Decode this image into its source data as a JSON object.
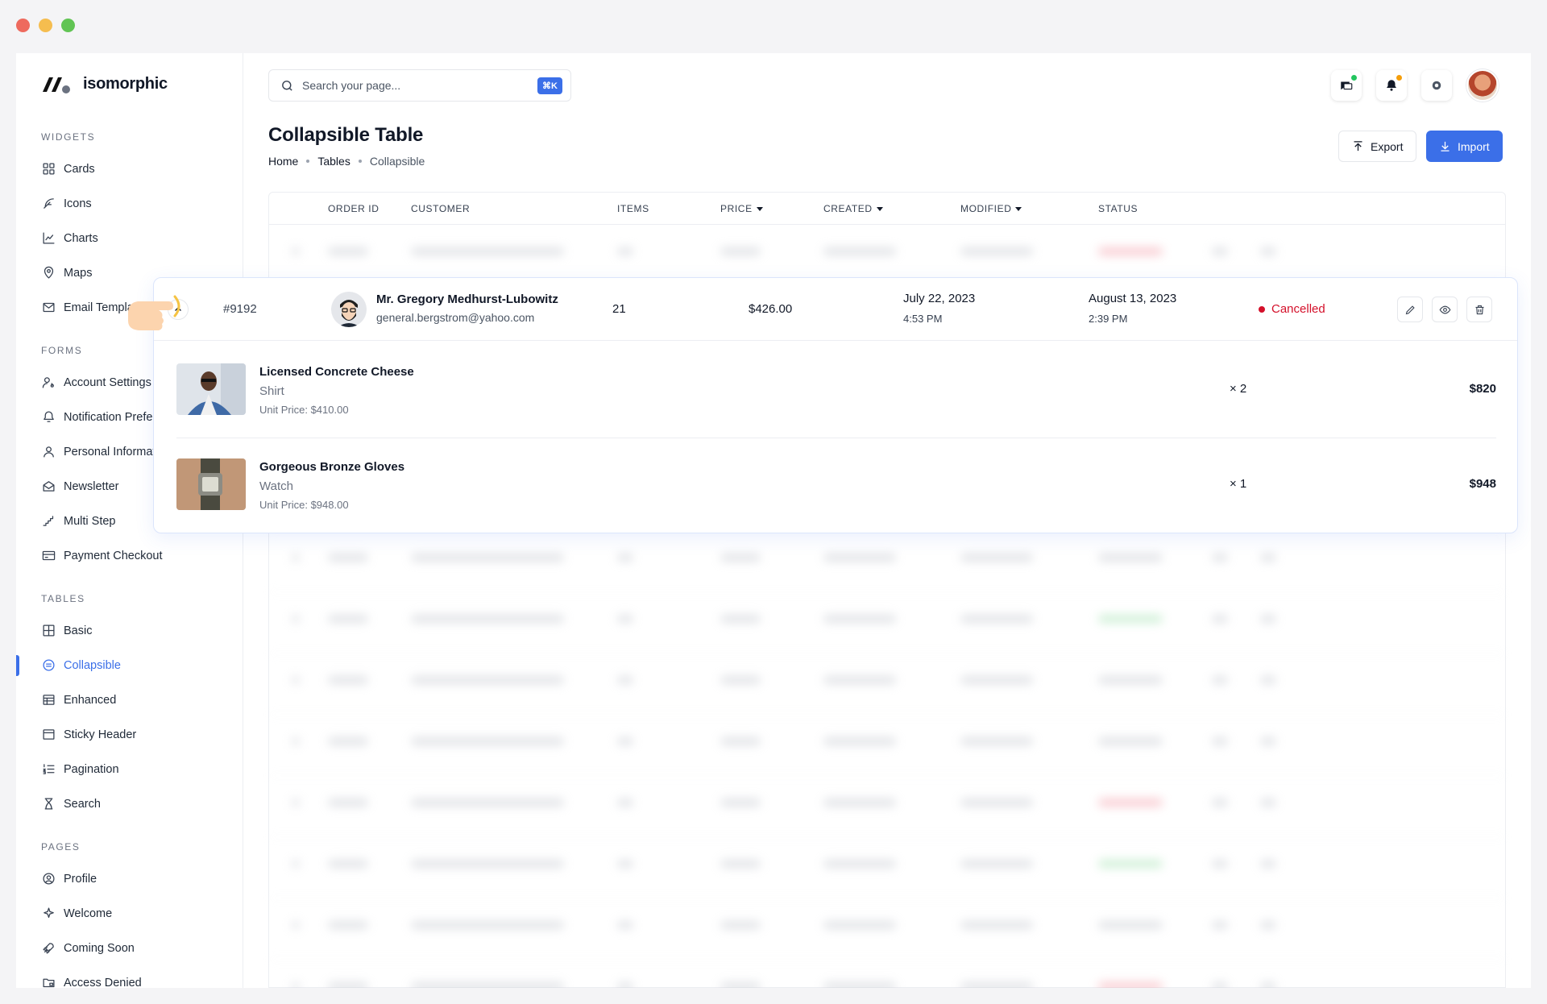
{
  "app": {
    "brand": "isomorphic"
  },
  "search": {
    "placeholder": "Search your page...",
    "shortcut": "⌘K"
  },
  "header": {
    "icons": [
      {
        "name": "messages-icon",
        "dot_color": "#22c55e"
      },
      {
        "name": "bell-icon",
        "dot_color": "#f59e0b"
      },
      {
        "name": "gear-icon"
      }
    ]
  },
  "sidebar": {
    "sections": [
      {
        "title": "WIDGETS",
        "items": [
          {
            "label": "Cards",
            "icon": "cards-icon"
          },
          {
            "label": "Icons",
            "icon": "feather-icon"
          },
          {
            "label": "Charts",
            "icon": "chart-icon"
          },
          {
            "label": "Maps",
            "icon": "map-pin-icon"
          },
          {
            "label": "Email Templates",
            "icon": "mail-icon"
          }
        ]
      },
      {
        "title": "FORMS",
        "items": [
          {
            "label": "Account Settings",
            "icon": "user-gear-icon"
          },
          {
            "label": "Notification Preferences",
            "icon": "bell-outline-icon"
          },
          {
            "label": "Personal Information",
            "icon": "user-icon"
          },
          {
            "label": "Newsletter",
            "icon": "envelope-open-icon"
          },
          {
            "label": "Multi Step",
            "icon": "steps-icon"
          },
          {
            "label": "Payment Checkout",
            "icon": "credit-card-icon"
          }
        ]
      },
      {
        "title": "TABLES",
        "items": [
          {
            "label": "Basic",
            "icon": "grid-icon"
          },
          {
            "label": "Collapsible",
            "icon": "collapse-icon",
            "active": true
          },
          {
            "label": "Enhanced",
            "icon": "table-icon"
          },
          {
            "label": "Sticky Header",
            "icon": "window-icon"
          },
          {
            "label": "Pagination",
            "icon": "list-numbers-icon"
          },
          {
            "label": "Search",
            "icon": "hourglass-icon"
          }
        ]
      },
      {
        "title": "PAGES",
        "items": [
          {
            "label": "Profile",
            "icon": "profile-icon"
          },
          {
            "label": "Welcome",
            "icon": "sparkle-icon"
          },
          {
            "label": "Coming Soon",
            "icon": "rocket-icon"
          },
          {
            "label": "Access Denied",
            "icon": "folder-lock-icon"
          }
        ]
      }
    ]
  },
  "page": {
    "title": "Collapsible Table",
    "breadcrumb": [
      "Home",
      "Tables",
      "Collapsible"
    ],
    "export_label": "Export",
    "import_label": "Import"
  },
  "table": {
    "columns": [
      {
        "label": "ORDER ID",
        "sortable": false
      },
      {
        "label": "CUSTOMER",
        "sortable": false
      },
      {
        "label": "ITEMS",
        "sortable": false
      },
      {
        "label": "PRICE",
        "sortable": true
      },
      {
        "label": "CREATED",
        "sortable": true
      },
      {
        "label": "MODIFIED",
        "sortable": true
      },
      {
        "label": "STATUS",
        "sortable": false
      }
    ],
    "expanded_row": {
      "order_id": "#9192",
      "customer_name": "Mr. Gregory Medhurst-Lubowitz",
      "customer_email": "general.bergstrom@yahoo.com",
      "items": "21",
      "price": "$426.00",
      "created_date": "July 22, 2023",
      "created_time": "4:53 PM",
      "modified_date": "August 13, 2023",
      "modified_time": "2:39 PM",
      "status": "Cancelled",
      "status_color": "#d4102a",
      "products": [
        {
          "name": "Licensed Concrete Cheese",
          "category": "Shirt",
          "unit_price": "Unit Price: $410.00",
          "qty": "× 2",
          "total": "$820"
        },
        {
          "name": "Gorgeous Bronze Gloves",
          "category": "Watch",
          "unit_price": "Unit Price: $948.00",
          "qty": "× 1",
          "total": "$948"
        }
      ]
    }
  },
  "colors": {
    "accent": "#3b6fe8",
    "cancelled": "#d4102a"
  }
}
